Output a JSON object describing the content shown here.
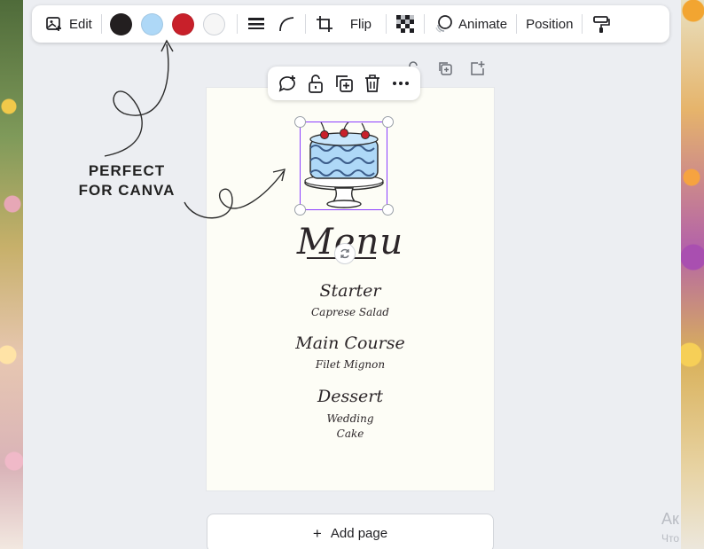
{
  "toolbar": {
    "edit_label": "Edit",
    "colors": [
      "#231f20",
      "#aed8f7",
      "#c8202a",
      "#f6f6f6"
    ],
    "flip_label": "Flip",
    "animate_label": "Animate",
    "position_label": "Position"
  },
  "promo": {
    "line1": "PERFECT",
    "line2": "FOR CANVA"
  },
  "menu": {
    "title": "Menu",
    "starter_heading": "Starter",
    "starter_item": "Caprese Salad",
    "main_heading": "Main Course",
    "main_item": "Filet Mignon",
    "dessert_heading": "Dessert",
    "dessert_item_line1": "Wedding",
    "dessert_item_line2": "Cake"
  },
  "add_page_label": "Add page",
  "watermark": {
    "line1": "Ак",
    "line2": "Что"
  }
}
